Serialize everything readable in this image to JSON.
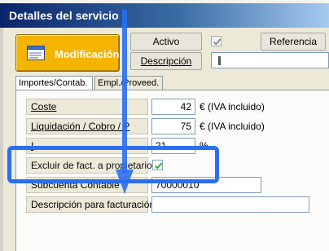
{
  "window": {
    "title": "Detalles del servicio"
  },
  "toolbar": {
    "modify_label": "Modificación",
    "activo_label": "Activo",
    "description_label": "Descripción",
    "reference_label": "Referencia"
  },
  "tabs": [
    {
      "label": "Importes/Contab."
    },
    {
      "label": "Empl./Proveed."
    }
  ],
  "fields": {
    "coste": {
      "label": "Coste",
      "value": "42",
      "unit": "€ (IVA incluido)"
    },
    "liquidacion": {
      "label": "Liquidación / Cobro / P",
      "value": "75",
      "unit": "€ (IVA incluido)"
    },
    "third": {
      "label": "I",
      "value": "21",
      "unit": "%"
    },
    "excluir": {
      "label": "Excluir de fact. a propietarios",
      "checked": true
    },
    "subcuenta": {
      "label": "Subcuenta Contable",
      "value": "70000010"
    },
    "desc_fact": {
      "label": "Descripción para facturación",
      "value": ""
    }
  },
  "colors": {
    "highlight": "#2b6ff0",
    "modify_button": "#f5b400"
  },
  "icons": {
    "modify": "form-edit-icon",
    "activo_check": "checkmark-icon"
  }
}
